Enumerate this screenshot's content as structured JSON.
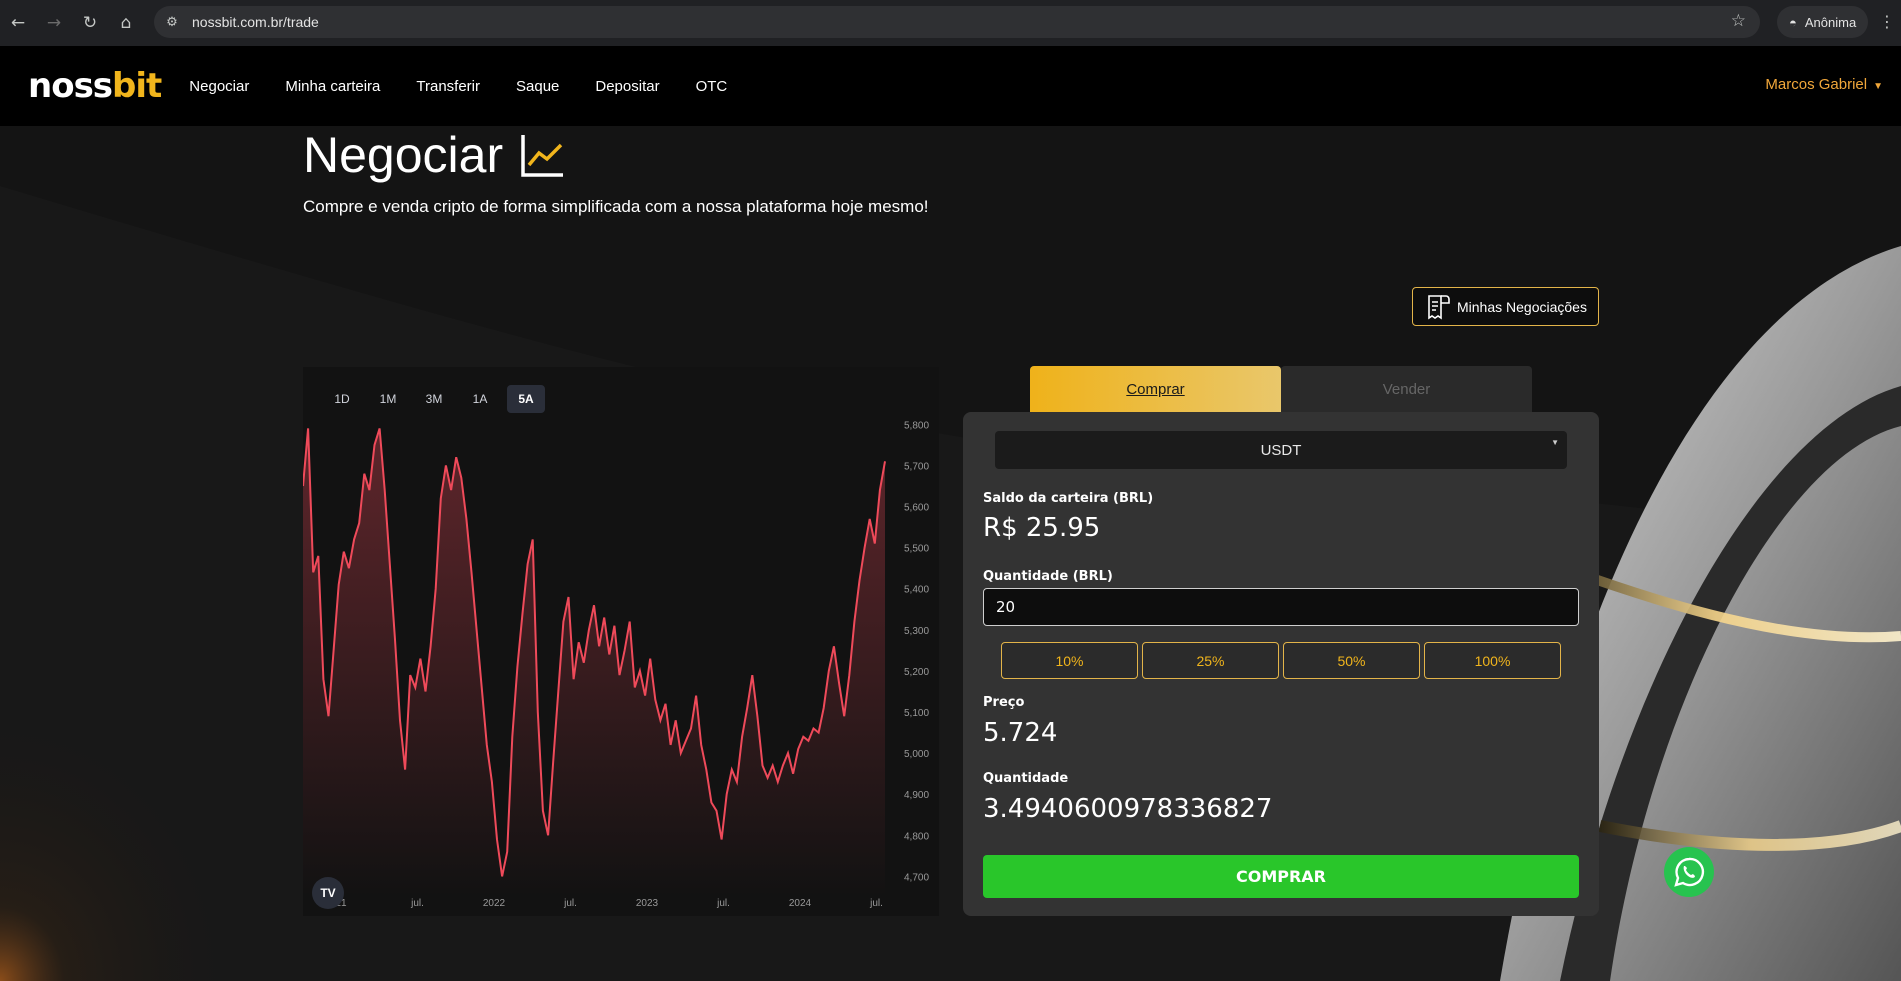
{
  "browser": {
    "url": "nossbit.com.br/trade",
    "profile_label": "Anônima"
  },
  "nav": {
    "logo_main": "noss",
    "logo_accent": "bit",
    "items": [
      "Negociar",
      "Minha carteira",
      "Transferir",
      "Saque",
      "Depositar",
      "OTC"
    ],
    "user": "Marcos Gabriel"
  },
  "page": {
    "title": "Negociar",
    "subtitle": "Compre e venda cripto de forma simplificada com a nossa plataforma hoje mesmo!",
    "history_button": "Minhas Negociações"
  },
  "chart": {
    "ranges": [
      "1D",
      "1M",
      "3M",
      "1A",
      "5A"
    ],
    "active_range": "5A",
    "tv_logo": "TV"
  },
  "chart_data": {
    "type": "area",
    "title": "",
    "x_tick_labels": [
      "21",
      "jul.",
      "2022",
      "jul.",
      "2023",
      "jul.",
      "2024",
      "jul."
    ],
    "y_tick_labels": [
      "5,800",
      "5,700",
      "5,600",
      "5,500",
      "5,400",
      "5,300",
      "5,200",
      "5,100",
      "5,000",
      "4,900",
      "4,800",
      "4,700"
    ],
    "ylim": [
      4650,
      5830
    ],
    "series": [
      {
        "values": [
          5650,
          5790,
          5440,
          5480,
          5180,
          5090,
          5250,
          5410,
          5490,
          5450,
          5520,
          5560,
          5680,
          5640,
          5750,
          5790,
          5640,
          5460,
          5280,
          5080,
          4960,
          5190,
          5160,
          5230,
          5150,
          5260,
          5400,
          5620,
          5700,
          5640,
          5720,
          5670,
          5570,
          5440,
          5300,
          5160,
          5020,
          4930,
          4790,
          4700,
          4760,
          5040,
          5210,
          5340,
          5460,
          5520,
          5100,
          4860,
          4800,
          4980,
          5150,
          5320,
          5380,
          5180,
          5270,
          5220,
          5300,
          5360,
          5260,
          5330,
          5240,
          5310,
          5190,
          5250,
          5320,
          5160,
          5200,
          5140,
          5230,
          5130,
          5080,
          5120,
          5020,
          5080,
          5000,
          5030,
          5060,
          5140,
          5020,
          4960,
          4880,
          4860,
          4790,
          4900,
          4960,
          4930,
          5040,
          5110,
          5190,
          5090,
          4970,
          4940,
          4970,
          4930,
          4970,
          5000,
          4950,
          5010,
          5040,
          5030,
          5060,
          5050,
          5110,
          5200,
          5260,
          5170,
          5090,
          5190,
          5320,
          5420,
          5500,
          5570,
          5510,
          5640,
          5710
        ]
      }
    ],
    "line_color": "#ef4a5a",
    "grid": false
  },
  "trade": {
    "tab_buy": "Comprar",
    "tab_sell": "Vender",
    "asset": "USDT",
    "balance_label": "Saldo da carteira (BRL)",
    "balance_value": "R$ 25.95",
    "qty_label": "Quantidade (BRL)",
    "qty_value": "20",
    "percents": [
      "10%",
      "25%",
      "50%",
      "100%"
    ],
    "price_label": "Preço",
    "price_value": "5.724",
    "amount_label": "Quantidade",
    "amount_value": "3.4940600978336827",
    "submit": "COMPRAR"
  }
}
